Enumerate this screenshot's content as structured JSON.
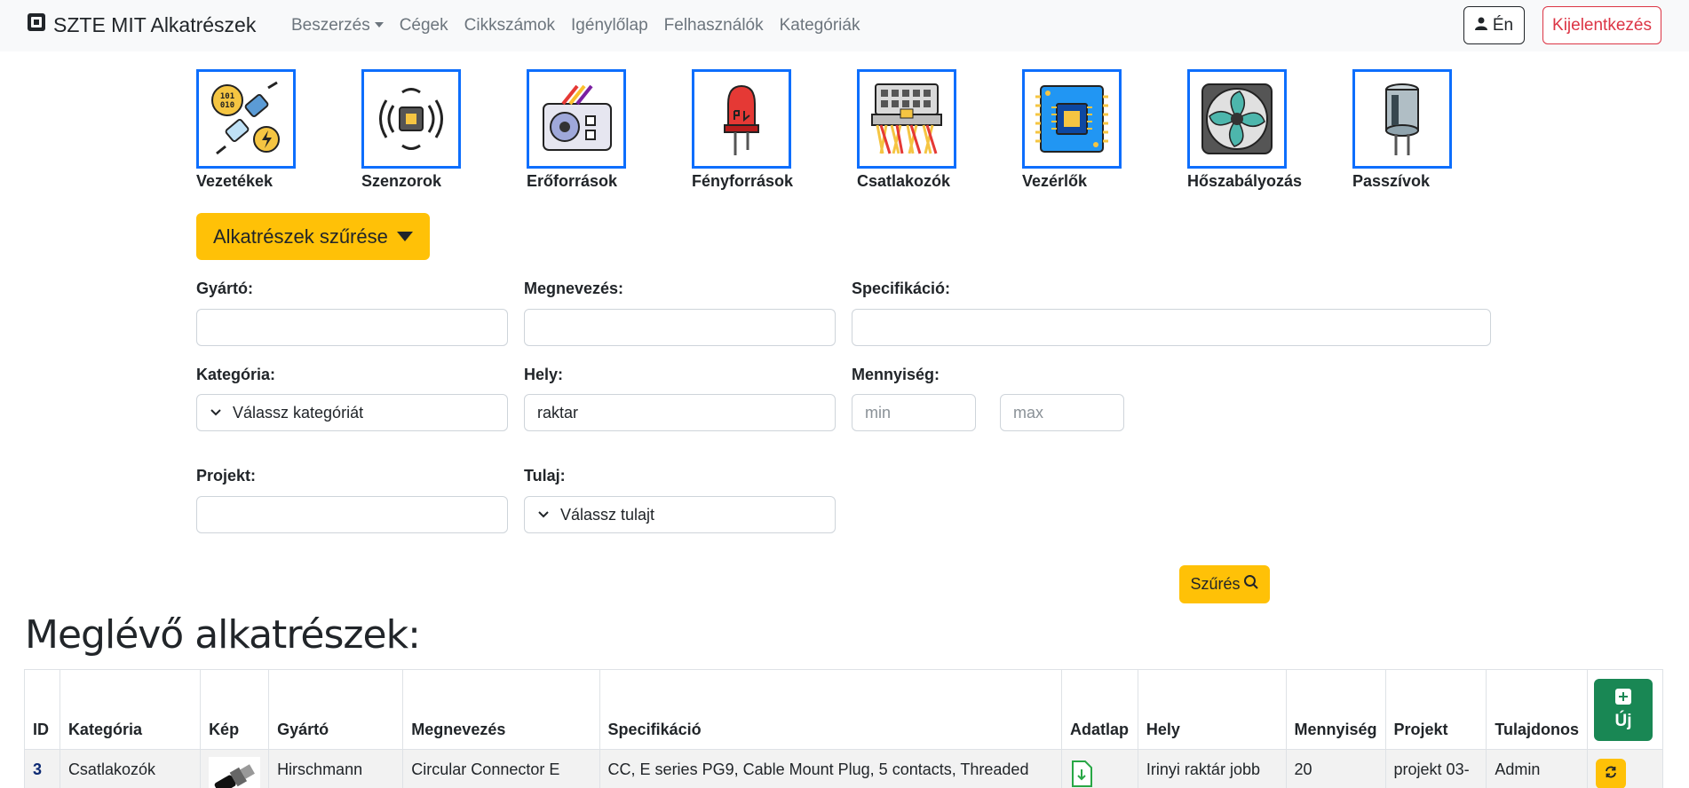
{
  "navbar": {
    "brand": "SZTE MIT Alkatrészek",
    "links": [
      "Beszerzés",
      "Cégek",
      "Cikkszámok",
      "Igénylőlap",
      "Felhasználók",
      "Kategóriák"
    ],
    "me_label": "Én",
    "logout_label": "Kijelentkezés"
  },
  "categories": [
    {
      "label": "Vezetékek",
      "icon": "cables-icon"
    },
    {
      "label": "Szenzorok",
      "icon": "sensor-chip-icon"
    },
    {
      "label": "Erőforrások",
      "icon": "power-supply-icon"
    },
    {
      "label": "Fényforrások",
      "icon": "led-icon"
    },
    {
      "label": "Csatlakozók",
      "icon": "connector-icon"
    },
    {
      "label": "Vezérlők",
      "icon": "circuit-board-icon"
    },
    {
      "label": "Hőszabályozás",
      "icon": "fan-icon"
    },
    {
      "label": "Passzívok",
      "icon": "capacitor-icon"
    }
  ],
  "filter": {
    "toggle_label": "Alkatrészek szűrése",
    "manufacturer_label": "Gyártó:",
    "manufacturer_value": "",
    "name_label": "Megnevezés:",
    "name_value": "",
    "spec_label": "Specifikáció:",
    "spec_value": "",
    "category_label": "Kategória:",
    "category_placeholder": "Válassz kategóriát",
    "location_label": "Hely:",
    "location_value": "raktar",
    "quantity_label": "Mennyiség:",
    "quantity_min_placeholder": "min",
    "quantity_max_placeholder": "max",
    "project_label": "Projekt:",
    "project_value": "",
    "owner_label": "Tulaj:",
    "owner_placeholder": "Válassz tulajt",
    "search_label": "Szűrés"
  },
  "parts": {
    "heading": "Meglévő alkatrészek:",
    "columns": [
      "ID",
      "Kategória",
      "Kép",
      "Gyártó",
      "Megnevezés",
      "Specifikáció",
      "Adatlap",
      "Hely",
      "Mennyiség",
      "Projekt",
      "Tulajdonos"
    ],
    "new_label": "Új",
    "rows": [
      {
        "id": "3",
        "category": "Csatlakozók",
        "manufacturer": "Hirschmann",
        "name": "Circular Connector E",
        "spec": "CC, E series PG9, Cable Mount Plug, 5 contacts, Threaded",
        "location": "Irinyi raktár jobb",
        "quantity": "20",
        "project": "projekt 03-",
        "owner": "Admin"
      }
    ]
  },
  "colors": {
    "primary": "#0d6efd",
    "warning": "#ffc107",
    "danger": "#dc3545",
    "success": "#198754",
    "navbar_bg": "#f8f9fa"
  }
}
